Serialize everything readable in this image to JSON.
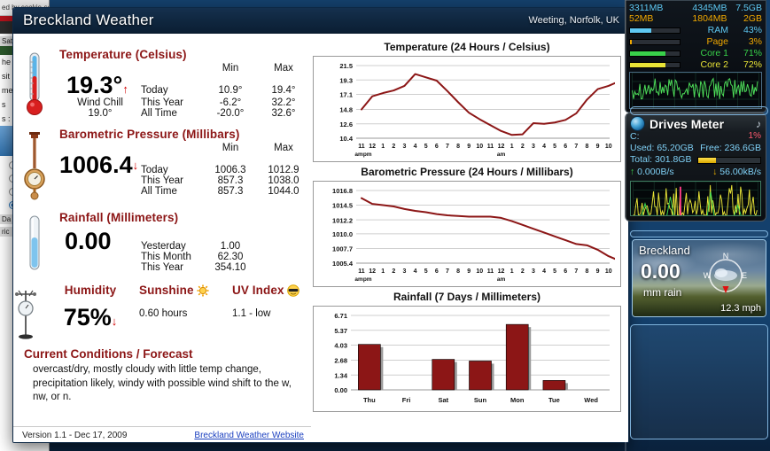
{
  "window": {
    "title": "Breckland Weather",
    "location": "Weeting, Norfolk, UK"
  },
  "temperature": {
    "section_title": "Temperature (Celsius)",
    "current": "19.3°",
    "trend": "↑",
    "wind_chill_label": "Wind Chill",
    "wind_chill_value": "19.0°",
    "col_min": "Min",
    "col_max": "Max",
    "rows": [
      {
        "label": "Today",
        "min": "10.9°",
        "max": "19.4°"
      },
      {
        "label": "This Year",
        "min": "-6.2°",
        "max": "32.2°"
      },
      {
        "label": "All Time",
        "min": "-20.0°",
        "max": "32.6°"
      }
    ]
  },
  "pressure": {
    "section_title": "Barometric Pressure (Millibars)",
    "current": "1006.4",
    "trend": "↓",
    "col_min": "Min",
    "col_max": "Max",
    "rows": [
      {
        "label": "Today",
        "min": "1006.3",
        "max": "1012.9"
      },
      {
        "label": "This Year",
        "min": "857.3",
        "max": "1038.0"
      },
      {
        "label": "All Time",
        "min": "857.3",
        "max": "1044.0"
      }
    ]
  },
  "rainfall": {
    "section_title": "Rainfall (Millimeters)",
    "current": "0.00",
    "rows": [
      {
        "label": "Yesterday",
        "value": "1.00"
      },
      {
        "label": "This Month",
        "value": "62.30"
      },
      {
        "label": "This Year",
        "value": "354.10"
      }
    ]
  },
  "humidity": {
    "section_title": "Humidity",
    "current": "75%",
    "trend": "↓"
  },
  "sunshine": {
    "section_title": "Sunshine",
    "icon": "sun-icon",
    "value": "0.60 hours"
  },
  "uv": {
    "section_title": "UV Index",
    "icon": "sunglasses-face-icon",
    "value": "1.1 - low"
  },
  "forecast": {
    "title": "Current Conditions / Forecast",
    "text": "overcast/dry, mostly cloudy with little temp change, precipitation likely, windy with possible wind shift to the w, nw, or n."
  },
  "footer": {
    "version": "Version 1.1 - Dec 17, 2009",
    "link": "Breckland Weather Website"
  },
  "chart_data": [
    {
      "type": "line",
      "title": "Temperature (24 Hours / Celsius)",
      "xlabel": "",
      "ylabel": "",
      "ylim": [
        10.4,
        21.5
      ],
      "yticks": [
        10.4,
        12.6,
        14.8,
        17.1,
        19.3,
        21.5
      ],
      "ytick_labels": [
        "10.4",
        "12.6",
        "14.8",
        "17.1",
        "19.3",
        "21.5"
      ],
      "grid": true,
      "legend": "none",
      "x": [
        "11",
        "12",
        "1",
        "2",
        "3",
        "4",
        "5",
        "6",
        "7",
        "8",
        "9",
        "10",
        "11",
        "12",
        "1",
        "2",
        "3",
        "4",
        "5",
        "6",
        "7",
        "8",
        "9",
        "10"
      ],
      "xaxis_notes": [
        "ampm",
        "am"
      ],
      "values": [
        14.8,
        16.8,
        17.3,
        17.7,
        18.4,
        20.2,
        19.7,
        19.2,
        17.6,
        15.9,
        14.3,
        13.3,
        12.4,
        11.5,
        10.9,
        11.0,
        12.7,
        12.6,
        12.8,
        13.2,
        14.2,
        16.3,
        17.9,
        18.4,
        19.1
      ]
    },
    {
      "type": "line",
      "title": "Barometric Pressure (24 Hours / Millibars)",
      "xlabel": "",
      "ylabel": "",
      "ylim": [
        1005.4,
        1016.8
      ],
      "yticks": [
        1005.4,
        1007.7,
        1010.0,
        1012.2,
        1014.5,
        1016.8
      ],
      "ytick_labels": [
        "1005.4",
        "1007.7",
        "1010.0",
        "1012.2",
        "1014.5",
        "1016.8"
      ],
      "grid": true,
      "legend": "none",
      "x": [
        "11",
        "12",
        "1",
        "2",
        "3",
        "4",
        "5",
        "6",
        "7",
        "8",
        "9",
        "10",
        "11",
        "12",
        "1",
        "2",
        "3",
        "4",
        "5",
        "6",
        "7",
        "8",
        "9",
        "10"
      ],
      "xaxis_notes": [
        "ampm",
        "am"
      ],
      "values": [
        1015.6,
        1014.7,
        1014.5,
        1014.3,
        1013.9,
        1013.6,
        1013.4,
        1013.1,
        1012.9,
        1012.8,
        1012.7,
        1012.7,
        1012.7,
        1012.5,
        1012.0,
        1011.4,
        1010.8,
        1010.2,
        1009.6,
        1009.0,
        1008.4,
        1008.2,
        1007.5,
        1006.5,
        1005.8
      ]
    },
    {
      "type": "bar",
      "title": "Rainfall (7 Days / Millimeters)",
      "xlabel": "",
      "ylabel": "",
      "ylim": [
        0.0,
        6.71
      ],
      "yticks": [
        0.0,
        1.34,
        2.68,
        4.03,
        5.37,
        6.71
      ],
      "ytick_labels": [
        "0.00",
        "1.34",
        "2.68",
        "4.03",
        "5.37",
        "6.71"
      ],
      "grid": true,
      "legend": "none",
      "categories": [
        "Thu",
        "Fri",
        "Sat",
        "Sun",
        "Mon",
        "Tue",
        "Wed"
      ],
      "values": [
        4.1,
        0.0,
        2.75,
        2.6,
        5.9,
        0.85,
        0.0
      ]
    }
  ],
  "colors": {
    "accent_red": "#8c1616",
    "chart_line": "#8c1616",
    "bar_fill": "#8c1616",
    "title_bar": "#102841",
    "link": "#1a3fbf"
  },
  "sidebar": {
    "sysmon": {
      "row1": {
        "c1": "3311MB",
        "c2": "4345MB",
        "c3": "7.5GB"
      },
      "row2": {
        "c1": "52MB",
        "c2": "1804MB",
        "c3": "2GB"
      },
      "meters": [
        {
          "label": "RAM",
          "pct": "43%",
          "fill": 43,
          "color": "#5ec8f2"
        },
        {
          "label": "Page",
          "pct": "3%",
          "fill": 3,
          "color": "#f0a800"
        },
        {
          "label": "Core 1",
          "pct": "71%",
          "fill": 71,
          "color": "#39d24a"
        },
        {
          "label": "Core 2",
          "pct": "72%",
          "fill": 72,
          "color": "#e8e336"
        }
      ]
    },
    "drives": {
      "title": "Drives Meter",
      "drive": "C:",
      "pct": "1%",
      "used": "Used: 65.20GB",
      "free": "Free: 236.6GB",
      "total": "Total: 301.8GB",
      "up": "0.000B/s",
      "down": "56.00kB/s"
    },
    "breckland": {
      "name": "Breckland",
      "value": "0.00",
      "unit": "mm rain",
      "wind": "12.3 mph",
      "compass": {
        "n": "N",
        "e": "E",
        "w": "W"
      }
    }
  }
}
